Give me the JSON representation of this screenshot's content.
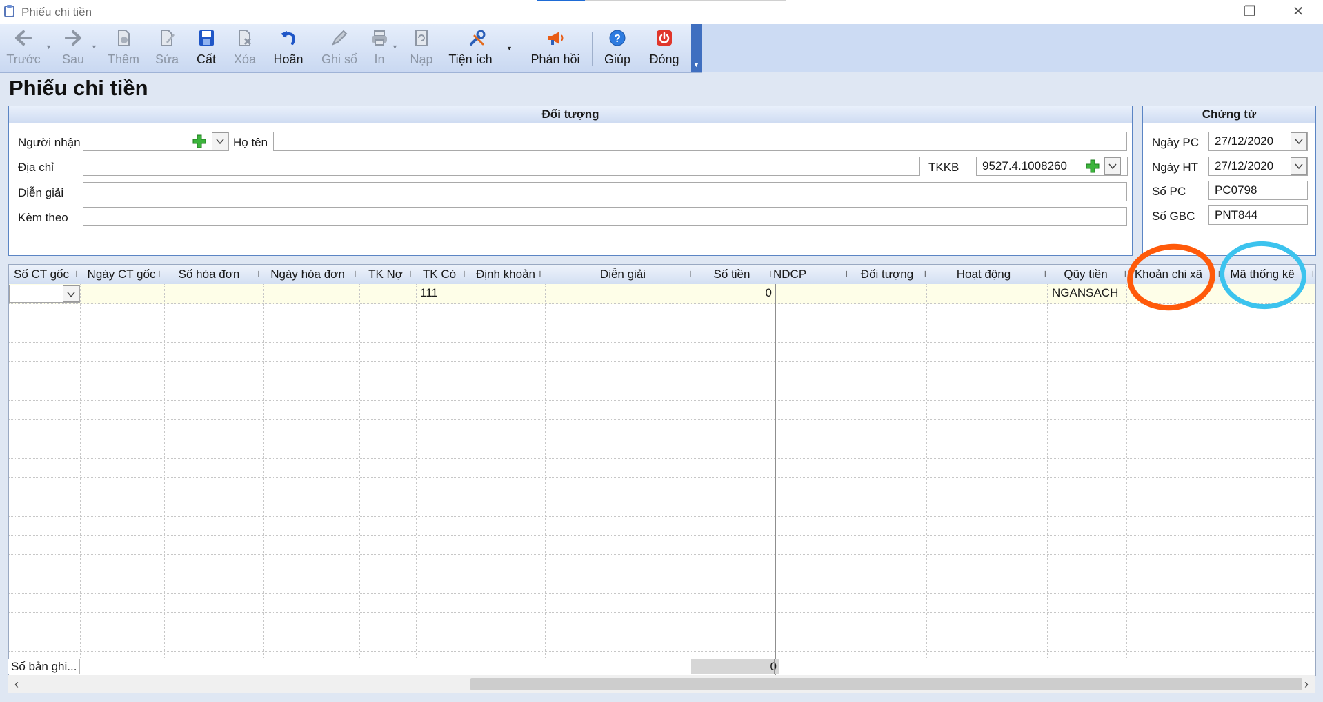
{
  "window": {
    "title": "Phiếu chi tiền",
    "restore_glyph": "❐",
    "close_glyph": "✕"
  },
  "toolbar": {
    "buttons": [
      {
        "label": "Trước",
        "icon": "arrow-left-icon",
        "enabled": false
      },
      {
        "label": "Sau",
        "icon": "arrow-right-icon",
        "enabled": false
      },
      {
        "label": "Thêm",
        "icon": "add-document-icon",
        "enabled": false
      },
      {
        "label": "Sửa",
        "icon": "edit-document-icon",
        "enabled": false
      },
      {
        "label": "Cất",
        "icon": "save-icon",
        "enabled": true
      },
      {
        "label": "Xóa",
        "icon": "delete-document-icon",
        "enabled": false
      },
      {
        "label": "Hoãn",
        "icon": "undo-icon",
        "enabled": true
      },
      {
        "label": "Ghi sổ",
        "icon": "pencil-icon",
        "enabled": false
      },
      {
        "label": "In",
        "icon": "printer-icon",
        "enabled": false
      },
      {
        "label": "Nạp",
        "icon": "reload-icon",
        "enabled": false
      },
      {
        "label": "Tiện ích",
        "icon": "tools-icon",
        "enabled": true
      },
      {
        "label": "Phản hồi",
        "icon": "megaphone-icon",
        "enabled": true
      },
      {
        "label": "Giúp",
        "icon": "help-icon",
        "enabled": true
      },
      {
        "label": "Đóng",
        "icon": "power-icon",
        "enabled": true
      }
    ]
  },
  "page_title": "Phiếu chi tiền",
  "doi_tuong": {
    "header": "Đối tượng",
    "nguoi_nhan_label": "Người nhận",
    "nguoi_nhan_value": "",
    "ho_ten_label": "Họ tên",
    "ho_ten_value": "",
    "dia_chi_label": "Địa chỉ",
    "dia_chi_value": "",
    "tkkb_label": "TKKB",
    "tkkb_value": "9527.4.1008260",
    "dien_giai_label": "Diễn giải",
    "dien_giai_value": "",
    "kem_theo_label": "Kèm theo",
    "kem_theo_value": ""
  },
  "chung_tu": {
    "header": "Chứng từ",
    "ngay_pc_label": "Ngày PC",
    "ngay_pc_value": "27/12/2020",
    "ngay_ht_label": "Ngày HT",
    "ngay_ht_value": "27/12/2020",
    "so_pc_label": "Số PC",
    "so_pc_value": "PC0798",
    "so_gbc_label": "Số GBC",
    "so_gbc_value": "PNT844"
  },
  "grid": {
    "columns": [
      {
        "label": "Số CT gốc"
      },
      {
        "label": "Ngày CT gốc"
      },
      {
        "label": "Số hóa đơn"
      },
      {
        "label": "Ngày hóa đơn"
      },
      {
        "label": "TK Nợ"
      },
      {
        "label": "TK Có"
      },
      {
        "label": "Định khoản"
      },
      {
        "label": "Diễn giải"
      },
      {
        "label": "Số tiền"
      },
      {
        "label": "NDCP"
      },
      {
        "label": "Đối tượng"
      },
      {
        "label": "Hoạt động"
      },
      {
        "label": "Qũy tiền"
      },
      {
        "label": "Khoản chi xã"
      },
      {
        "label": "Mã thống kê"
      }
    ],
    "first_row": {
      "tk_co": "111",
      "so_tien": "0",
      "quy_tien": "NGANSACH"
    },
    "footer_label": "Số bản ghi...",
    "footer_sum": "0"
  },
  "colors": {
    "annotation_orange": "#ff5a0a",
    "annotation_blue": "#3cc3ee",
    "accent": "#3f6fc0"
  }
}
